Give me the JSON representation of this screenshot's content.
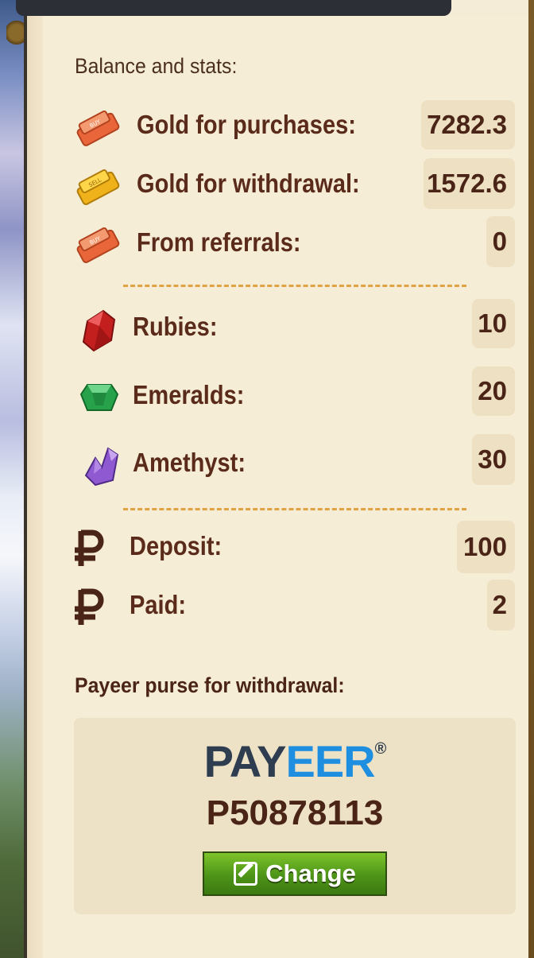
{
  "balance": {
    "section_title": "Balance and stats:",
    "gold_purchases": {
      "label": "Gold for purchases:",
      "value": "7282.3",
      "icon": "gold-bar-buy-icon",
      "color": "#f27a4a"
    },
    "gold_withdrawal": {
      "label": "Gold for withdrawal:",
      "value": "1572.6",
      "icon": "gold-bar-sell-icon",
      "color": "#f2b81f"
    },
    "from_referrals": {
      "label": "From referrals:",
      "value": "0",
      "icon": "gold-bar-buy-icon",
      "color": "#f27a4a"
    }
  },
  "gems": {
    "rubies": {
      "label": "Rubies:",
      "value": "10",
      "icon": "ruby-icon",
      "color": "#c72a2a"
    },
    "emeralds": {
      "label": "Emeralds:",
      "value": "20",
      "icon": "emerald-icon",
      "color": "#2aa04a"
    },
    "amethyst": {
      "label": "Amethyst:",
      "value": "30",
      "icon": "amethyst-icon",
      "color": "#8a54c8"
    }
  },
  "money": {
    "deposit": {
      "label": "Deposit:",
      "value": "100",
      "icon": "ruble-icon"
    },
    "paid": {
      "label": "Paid:",
      "value": "2",
      "icon": "ruble-icon"
    }
  },
  "payeer": {
    "section_title": "Payeer purse for withdrawal:",
    "logo_pay": "PAY",
    "logo_eer": "EER",
    "logo_reg": "®",
    "purse_id": "P50878113",
    "change_label": "Change",
    "button_icon": "edit-icon"
  },
  "colors": {
    "accent_text": "#5a2a1a",
    "divider": "#e0a243",
    "button_green": "#4d9418",
    "payeer_blue": "#1e8fe0"
  }
}
